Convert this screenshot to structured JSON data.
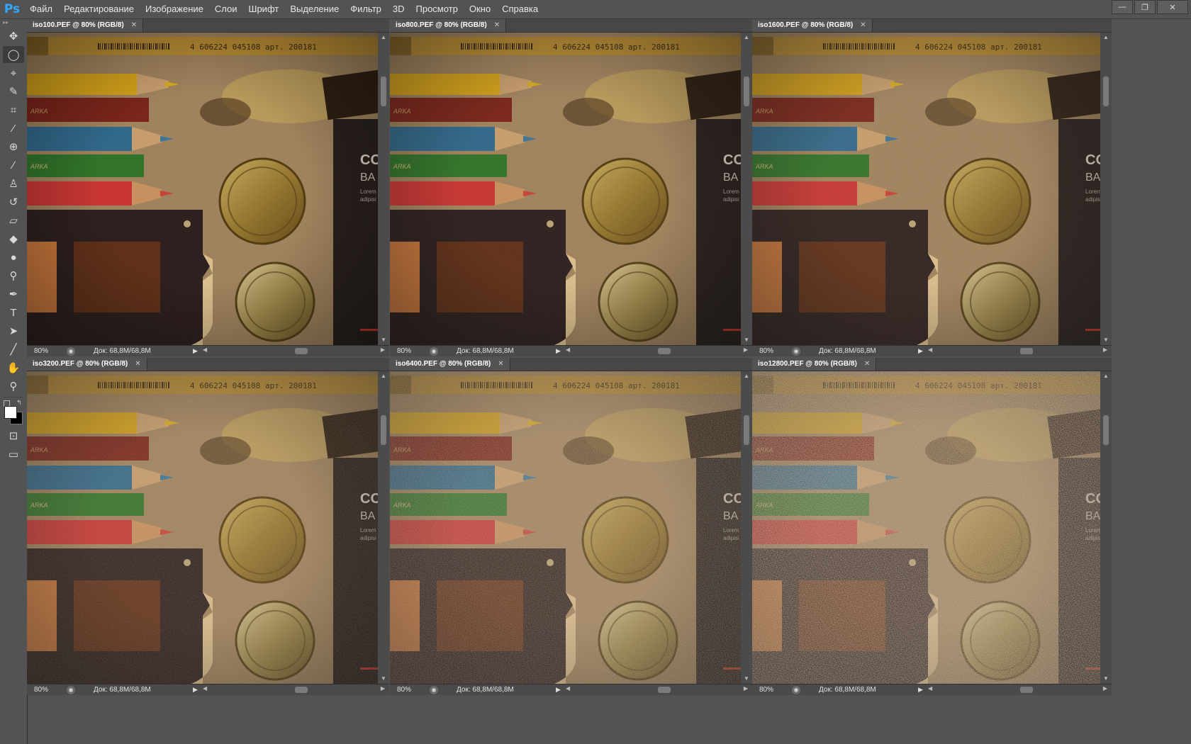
{
  "app": {
    "logo": "Ps"
  },
  "menu": [
    "Файл",
    "Редактирование",
    "Изображение",
    "Слои",
    "Шрифт",
    "Выделение",
    "Фильтр",
    "3D",
    "Просмотр",
    "Окно",
    "Справка"
  ],
  "window_controls": {
    "minimize": "—",
    "restore": "❐",
    "close": "✕"
  },
  "tools": [
    {
      "name": "move-tool-icon",
      "glyph": "✥"
    },
    {
      "name": "elliptical-marquee-tool-icon",
      "glyph": "◯"
    },
    {
      "name": "polygonal-lasso-tool-icon",
      "glyph": "⌖"
    },
    {
      "name": "quick-selection-tool-icon",
      "glyph": "✎"
    },
    {
      "name": "crop-tool-icon",
      "glyph": "⌗"
    },
    {
      "name": "eyedropper-tool-icon",
      "glyph": "⁄"
    },
    {
      "name": "spot-healing-tool-icon",
      "glyph": "⊕"
    },
    {
      "name": "brush-tool-icon",
      "glyph": "∕"
    },
    {
      "name": "clone-stamp-tool-icon",
      "glyph": "♙"
    },
    {
      "name": "history-brush-tool-icon",
      "glyph": "↺"
    },
    {
      "name": "eraser-tool-icon",
      "glyph": "▱"
    },
    {
      "name": "paint-bucket-tool-icon",
      "glyph": "◆"
    },
    {
      "name": "blur-tool-icon",
      "glyph": "●"
    },
    {
      "name": "dodge-tool-icon",
      "glyph": "⚲"
    },
    {
      "name": "pen-tool-icon",
      "glyph": "✒"
    },
    {
      "name": "type-tool-icon",
      "glyph": "T"
    },
    {
      "name": "path-selection-tool-icon",
      "glyph": "➤"
    },
    {
      "name": "line-tool-icon",
      "glyph": "╱"
    },
    {
      "name": "hand-tool-icon",
      "glyph": "✋"
    },
    {
      "name": "zoom-tool-icon",
      "glyph": "⚲"
    }
  ],
  "colors": {
    "foreground": "#ffffff",
    "background": "#000000"
  },
  "documents": [
    {
      "title": "iso100.PEF @ 80% (RGB/8)",
      "zoom": "80%",
      "doc_info": "Док: 68,8M/68,8M",
      "noise": 0.02
    },
    {
      "title": "iso800.PEF @ 80% (RGB/8)",
      "zoom": "80%",
      "doc_info": "Док: 68,8M/68,8M",
      "noise": 0.06
    },
    {
      "title": "iso1600.PEF @ 80% (RGB/8)",
      "zoom": "80%",
      "doc_info": "Док: 68,8M/68,8M",
      "noise": 0.12
    },
    {
      "title": "iso3200.PEF @ 80% (RGB/8)",
      "zoom": "80%",
      "doc_info": "Док: 68,8M/68,8M",
      "noise": 0.22
    },
    {
      "title": "iso6400.PEF @ 80% (RGB/8)",
      "zoom": "80%",
      "doc_info": "Док: 68,8M/68,8M",
      "noise": 0.38
    },
    {
      "title": "iso12800.PEF @ 80% (RGB/8)",
      "zoom": "80%",
      "doc_info": "Док: 68,8M/68,8M",
      "noise": 0.6
    }
  ],
  "photo": {
    "barcode_text": "4 606224 045108 арт. 200181",
    "brand_text": "ARKA",
    "box_text_1": "CO",
    "box_text_2": "BA",
    "box_small_1": "Lorem",
    "box_small_2": "adipisi",
    "pencil_colors": [
      "#e8b51a",
      "#7a1c1c",
      "#1f6fa6",
      "#1f7d2e",
      "#d8303a"
    ],
    "background_color": "#a88f6e",
    "swatch_colors": [
      "#d87f44",
      "#5a2a1a"
    ]
  }
}
